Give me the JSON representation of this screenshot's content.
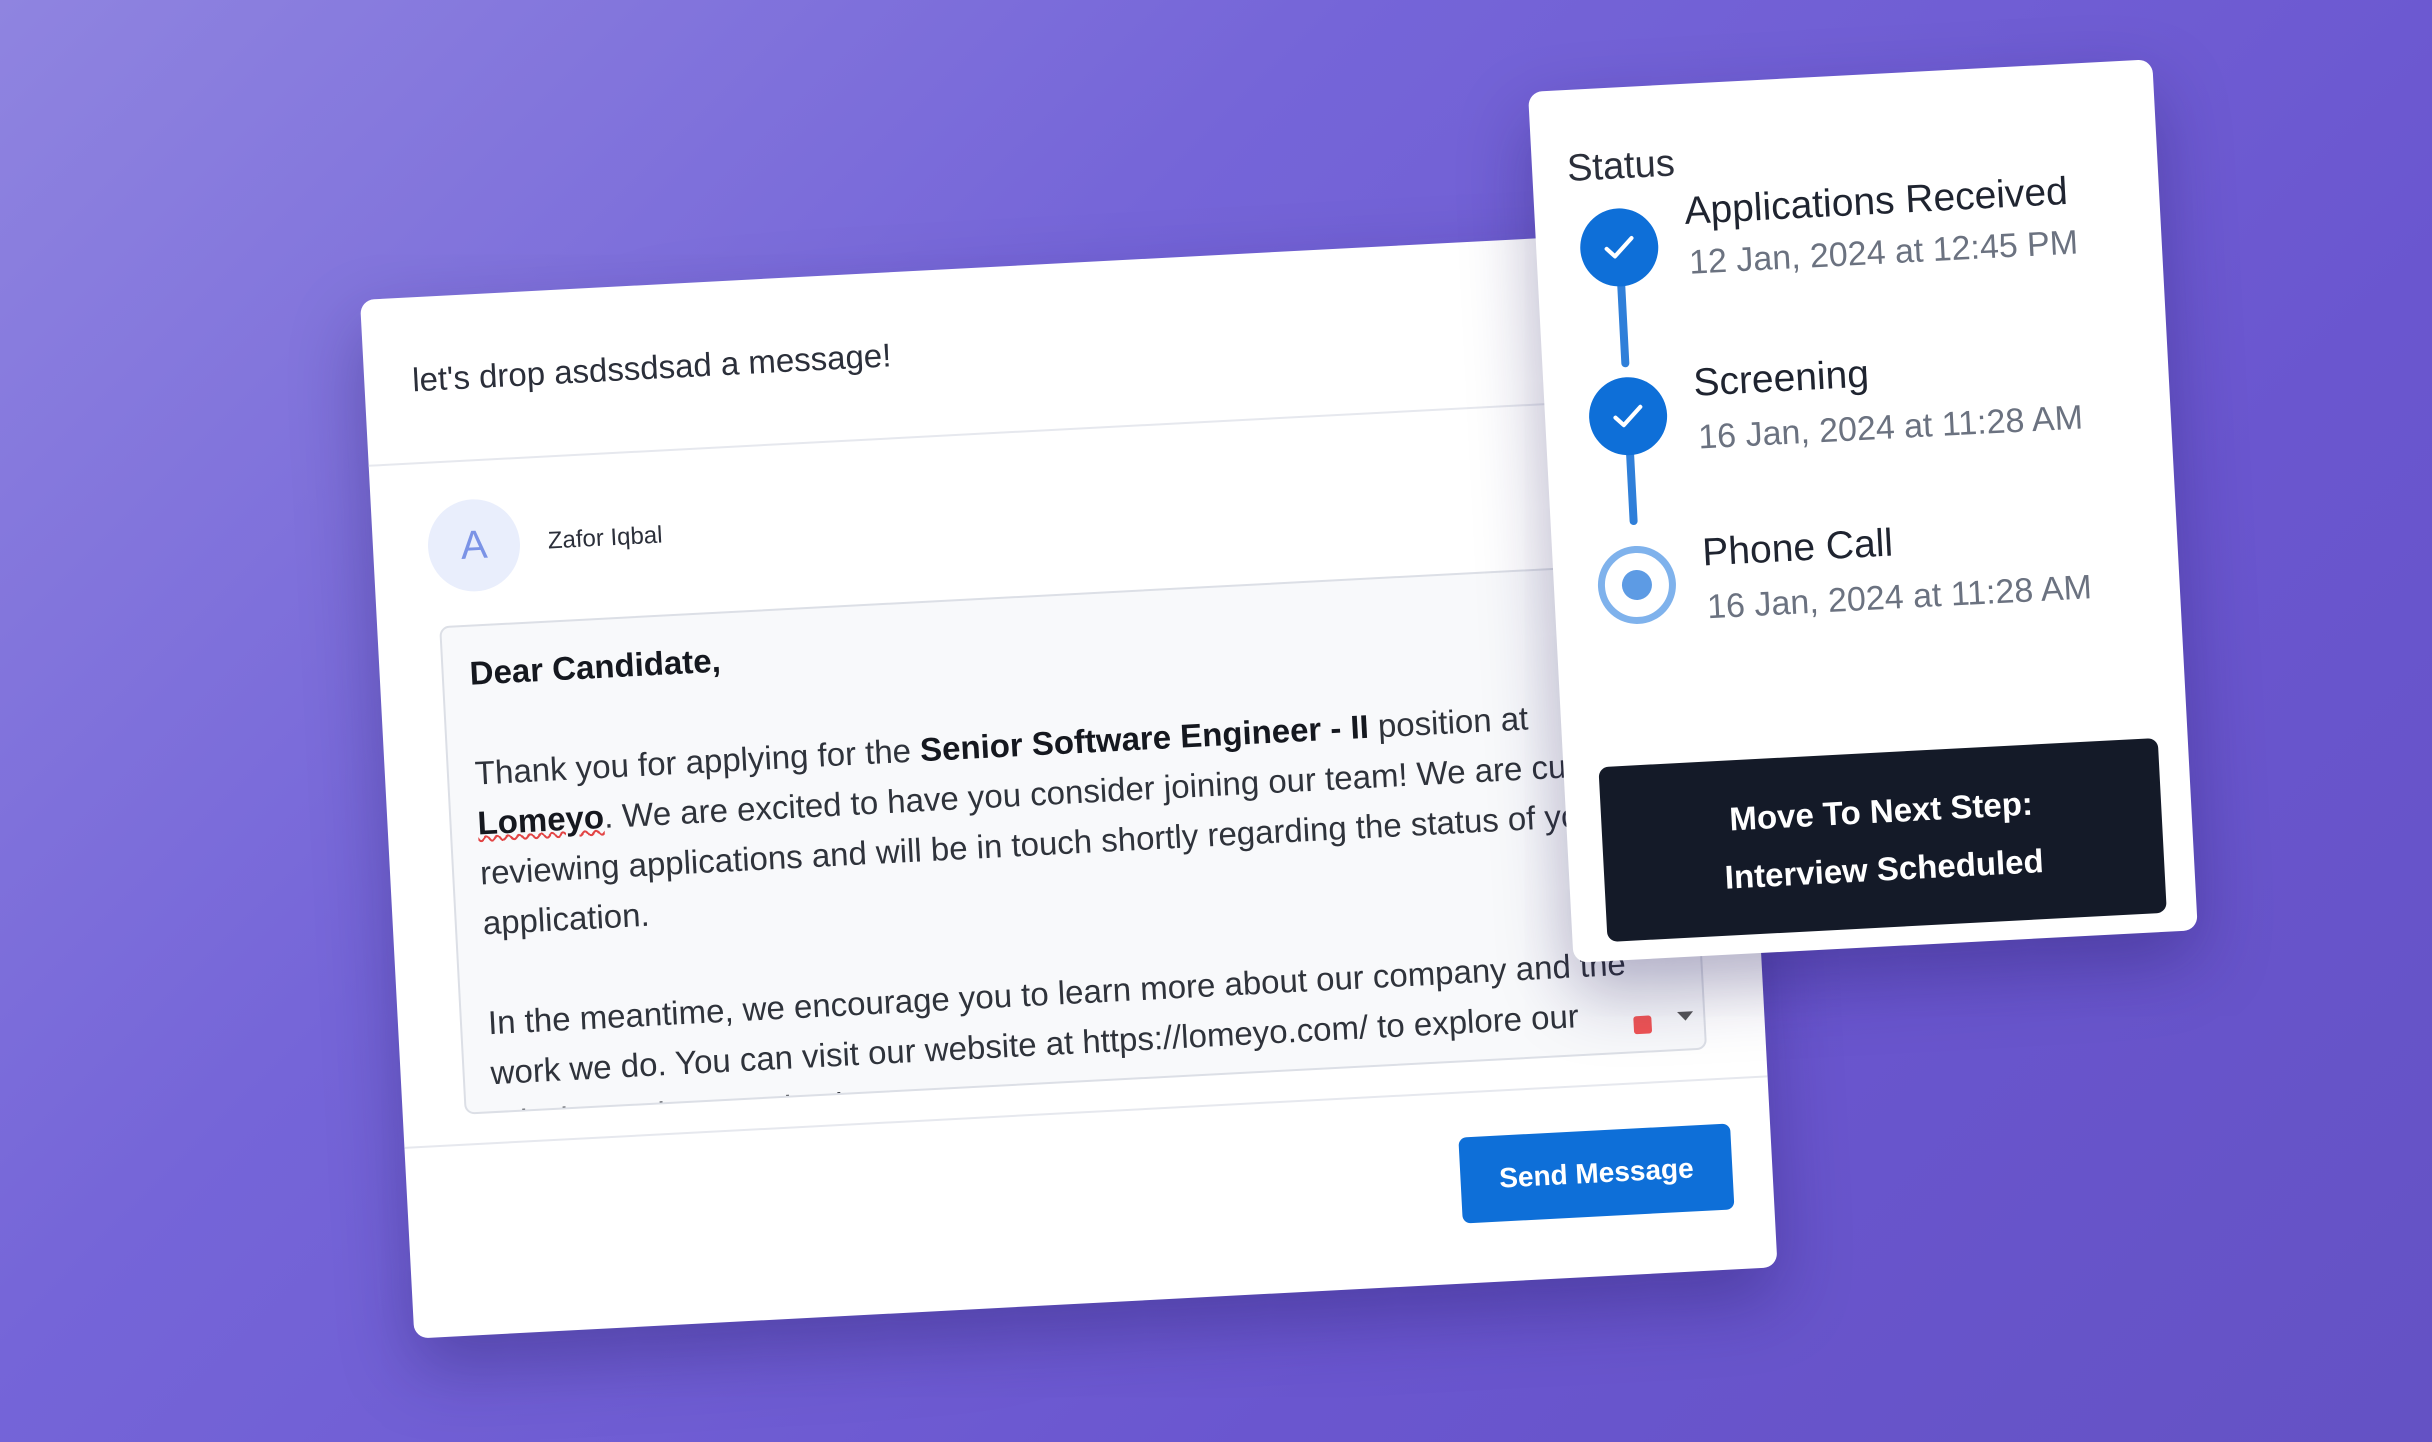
{
  "message_card": {
    "header_title": "let's drop asdssdsad a message!",
    "sender": {
      "avatar_initial": "A",
      "name": "Zafor Iqbal"
    },
    "body": {
      "greeting": "Dear Candidate,",
      "p1_start": "Thank you for applying for the ",
      "position": "Senior Software Engineer - II",
      "p1_mid": " position at ",
      "company": "Lomeyo",
      "p1_end": ". We are excited to have you consider joining our team! We are currently reviewing applications and will be in touch shortly regarding the status of your application.",
      "p2": "In the meantime, we encourage you to learn more about our company and the work we do. You can visit our website at https://lomeyo.com/ to explore our mission, values, and culture."
    },
    "send_label": "Send Message"
  },
  "status_card": {
    "title": "Status",
    "steps": [
      {
        "name": "Applications Received",
        "date": "12 Jan, 2024 at 12:45 PM",
        "state": "done"
      },
      {
        "name": "Screening",
        "date": "16 Jan, 2024 at 11:28 AM",
        "state": "done"
      },
      {
        "name": "Phone Call",
        "date": "16 Jan, 2024 at 11:28 AM",
        "state": "current"
      }
    ],
    "next_button": {
      "line1": "Move To Next Step:",
      "line2": "Interview Scheduled"
    }
  },
  "colors": {
    "accent": "#0e6fd8",
    "dark_button": "#141a28",
    "background": "#7565d8"
  },
  "icons": [
    "check-icon",
    "radio-current-icon",
    "chevron-down-icon"
  ]
}
